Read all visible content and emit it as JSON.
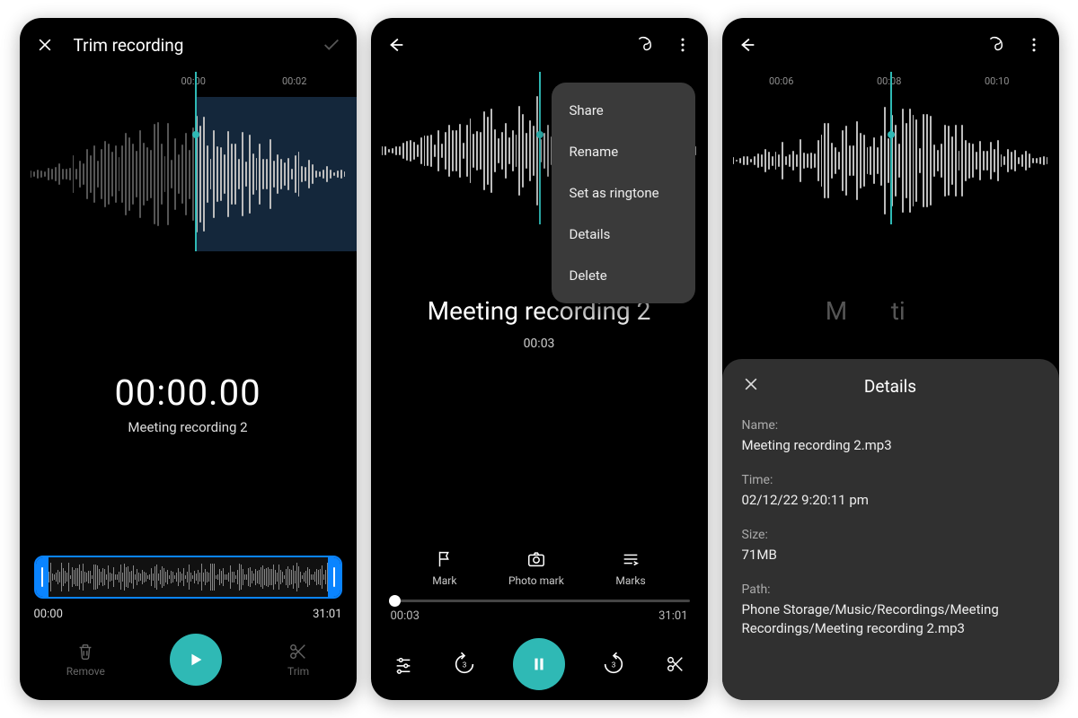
{
  "screen1": {
    "header_title": "Trim recording",
    "ruler": [
      "00:00",
      "00:02"
    ],
    "big_time": "00:00.00",
    "recording_name": "Meeting recording 2",
    "trim_start": "00:00",
    "trim_end": "31:01",
    "btn_remove": "Remove",
    "btn_trim": "Trim"
  },
  "screen2": {
    "title": "Meeting recording 2",
    "elapsed": "00:03",
    "slider_start": "00:03",
    "slider_end": "31:01",
    "actions": {
      "mark": "Mark",
      "photo": "Photo mark",
      "marks": "Marks"
    },
    "menu": [
      "Share",
      "Rename",
      "Set as ringtone",
      "Details",
      "Delete"
    ]
  },
  "screen3": {
    "ruler": [
      "00:06",
      "00:08",
      "00:10"
    ],
    "hidden_title_prefix": "M",
    "hidden_title_suffix": "ti",
    "sheet_title": "Details",
    "name_label": "Name:",
    "name_value": "Meeting recording 2.mp3",
    "time_label": "Time:",
    "time_value": "02/12/22 9:20:11 pm",
    "size_label": "Size:",
    "size_value": "71MB",
    "path_label": "Path:",
    "path_value": "Phone Storage/Music/Recordings/Meeting Recordings/Meeting recording 2.mp3"
  },
  "colors": {
    "accent": "#2fb9b5",
    "accent_blue": "#0a84ff"
  }
}
